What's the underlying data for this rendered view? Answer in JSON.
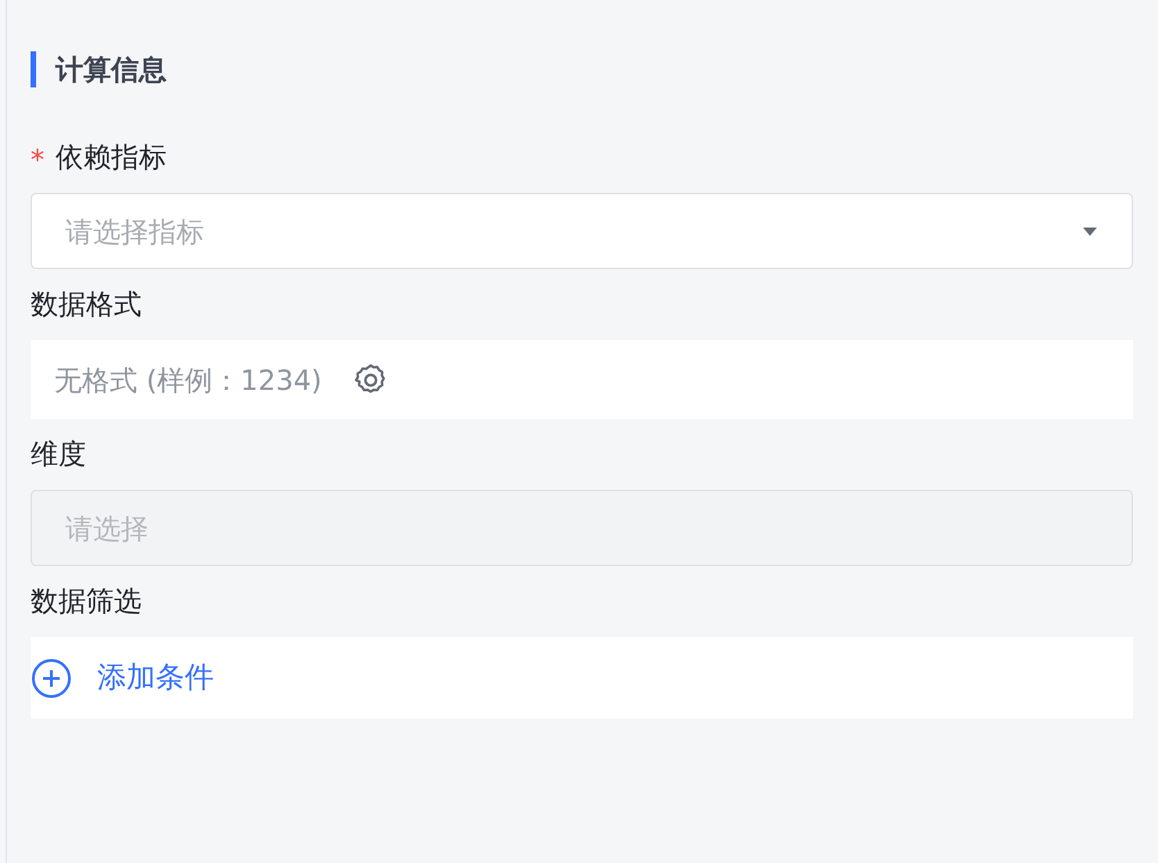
{
  "section": {
    "title": "计算信息"
  },
  "fields": [
    {
      "kind": "select",
      "label": "依赖指标",
      "required_mark": "*",
      "placeholder": "请选择指标",
      "disabled": false
    },
    {
      "kind": "format",
      "label": "数据格式",
      "value": "无格式 (样例：1234)"
    },
    {
      "kind": "select",
      "label": "维度",
      "placeholder": "请选择",
      "disabled": true
    },
    {
      "kind": "add",
      "label": "数据筛选",
      "action": "添加条件"
    }
  ]
}
